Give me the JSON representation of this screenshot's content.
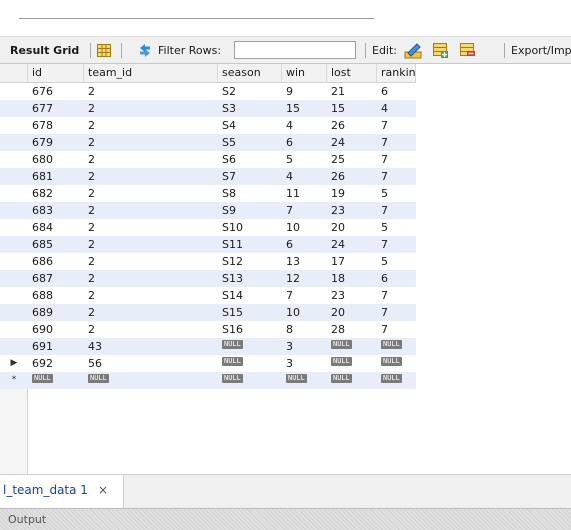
{
  "toolbar": {
    "result_grid_label": "Result Grid",
    "filter_label": "Filter Rows:",
    "filter_value": "",
    "edit_label": "Edit:",
    "export_label": "Export/Imp"
  },
  "grid": {
    "columns": [
      "id",
      "team_id",
      "season",
      "win",
      "lost",
      "ranking"
    ],
    "null_label": "NULL",
    "rows": [
      {
        "id": "676",
        "team_id": "2",
        "season": "S2",
        "win": "9",
        "lost": "21",
        "ranking": "6"
      },
      {
        "id": "677",
        "team_id": "2",
        "season": "S3",
        "win": "15",
        "lost": "15",
        "ranking": "4"
      },
      {
        "id": "678",
        "team_id": "2",
        "season": "S4",
        "win": "4",
        "lost": "26",
        "ranking": "7"
      },
      {
        "id": "679",
        "team_id": "2",
        "season": "S5",
        "win": "6",
        "lost": "24",
        "ranking": "7"
      },
      {
        "id": "680",
        "team_id": "2",
        "season": "S6",
        "win": "5",
        "lost": "25",
        "ranking": "7"
      },
      {
        "id": "681",
        "team_id": "2",
        "season": "S7",
        "win": "4",
        "lost": "26",
        "ranking": "7"
      },
      {
        "id": "682",
        "team_id": "2",
        "season": "S8",
        "win": "11",
        "lost": "19",
        "ranking": "5"
      },
      {
        "id": "683",
        "team_id": "2",
        "season": "S9",
        "win": "7",
        "lost": "23",
        "ranking": "7"
      },
      {
        "id": "684",
        "team_id": "2",
        "season": "S10",
        "win": "10",
        "lost": "20",
        "ranking": "5"
      },
      {
        "id": "685",
        "team_id": "2",
        "season": "S11",
        "win": "6",
        "lost": "24",
        "ranking": "7"
      },
      {
        "id": "686",
        "team_id": "2",
        "season": "S12",
        "win": "13",
        "lost": "17",
        "ranking": "5"
      },
      {
        "id": "687",
        "team_id": "2",
        "season": "S13",
        "win": "12",
        "lost": "18",
        "ranking": "6"
      },
      {
        "id": "688",
        "team_id": "2",
        "season": "S14",
        "win": "7",
        "lost": "23",
        "ranking": "7"
      },
      {
        "id": "689",
        "team_id": "2",
        "season": "S15",
        "win": "10",
        "lost": "20",
        "ranking": "7"
      },
      {
        "id": "690",
        "team_id": "2",
        "season": "S16",
        "win": "8",
        "lost": "28",
        "ranking": "7"
      },
      {
        "id": "691",
        "team_id": "43",
        "season": null,
        "win": "3",
        "lost": null,
        "ranking": null
      },
      {
        "id": "692",
        "team_id": "56",
        "season": null,
        "win": "3",
        "lost": null,
        "ranking": null,
        "marker": "▶"
      },
      {
        "id": null,
        "team_id": null,
        "season": null,
        "win": null,
        "lost": null,
        "ranking": null,
        "marker": "*"
      }
    ]
  },
  "tabs": [
    {
      "label": "l_team_data 1",
      "close": "×"
    }
  ],
  "output": {
    "label": "Output"
  },
  "icons": {
    "grid": "grid-icon",
    "refresh": "refresh-icon",
    "edit": "edit-pencil-icon",
    "add_row": "add-row-icon",
    "delete_row": "delete-row-icon"
  },
  "colors": {
    "row_alt": "#e8eef9",
    "tab_text": "#1f3f8f",
    "null_badge": "#7a7a7a"
  }
}
